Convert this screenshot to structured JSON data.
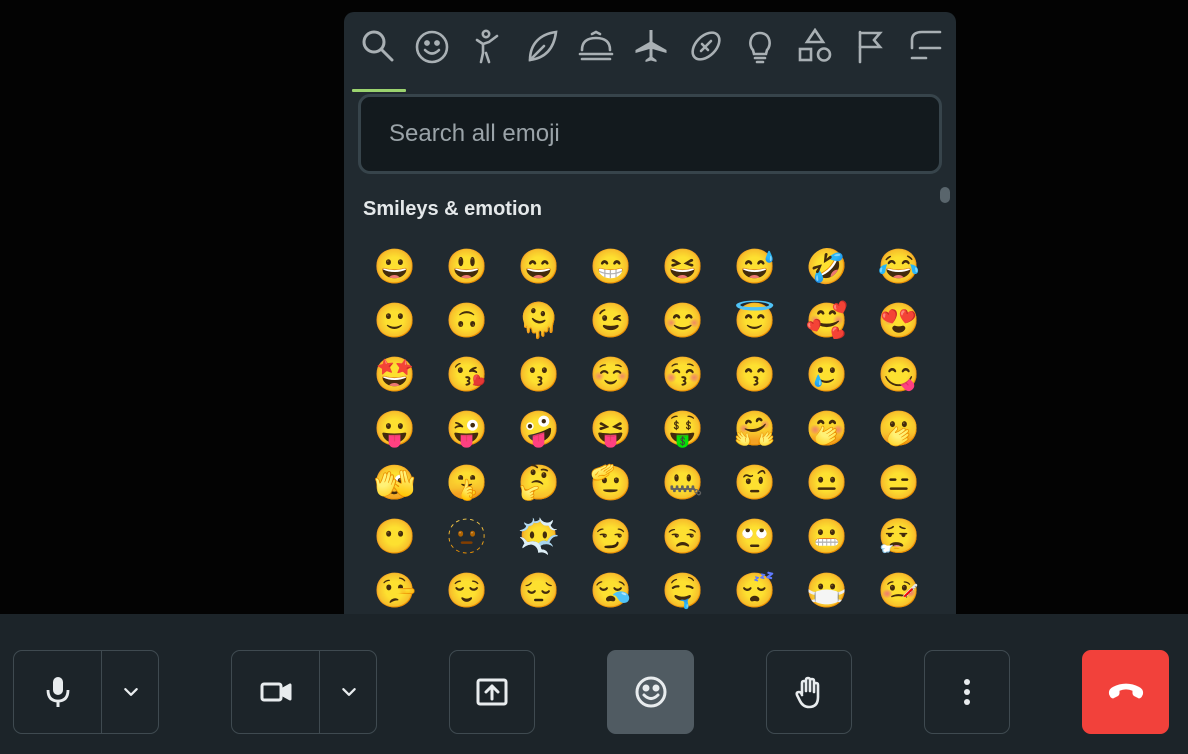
{
  "emoji_picker": {
    "categories": [
      {
        "name": "search-icon",
        "label": "Search"
      },
      {
        "name": "smiley-icon",
        "label": "Smileys & emotion"
      },
      {
        "name": "person-icon",
        "label": "People & body"
      },
      {
        "name": "leaf-icon",
        "label": "Animals & nature"
      },
      {
        "name": "food-icon",
        "label": "Food & drink"
      },
      {
        "name": "airplane-icon",
        "label": "Travel & places"
      },
      {
        "name": "football-icon",
        "label": "Activities"
      },
      {
        "name": "lightbulb-icon",
        "label": "Objects"
      },
      {
        "name": "shapes-icon",
        "label": "Symbols"
      },
      {
        "name": "flag-icon",
        "label": "Flags"
      },
      {
        "name": "custom-icon",
        "label": "Custom"
      }
    ],
    "active_category": "Search",
    "search": {
      "placeholder": "Search all emoji",
      "value": ""
    },
    "section_title": "Smileys & emotion",
    "emojis": [
      "😀",
      "😃",
      "😄",
      "😁",
      "😆",
      "😅",
      "🤣",
      "😂",
      "🙂",
      "🙃",
      "🫠",
      "😉",
      "😊",
      "😇",
      "🥰",
      "😍",
      "🤩",
      "😘",
      "😗",
      "☺️",
      "😚",
      "😙",
      "🥲",
      "😋",
      "😛",
      "😜",
      "🤪",
      "😝",
      "🤑",
      "🤗",
      "🤭",
      "🫢",
      "🫣",
      "🤫",
      "🤔",
      "🫡",
      "🤐",
      "🤨",
      "😐",
      "😑",
      "😶",
      "🫥",
      "😶‍🌫️",
      "😏",
      "😒",
      "🙄",
      "😬",
      "😮‍💨",
      "🤥",
      "😌",
      "😔",
      "😪",
      "🤤",
      "😴",
      "😷",
      "🤒",
      "🤕",
      "🤢",
      "🤮",
      "🤧",
      "🥵",
      "🥶",
      "🥴",
      "😵"
    ]
  },
  "toolbar": {
    "mic": {
      "icon": "microphone-icon",
      "options_icon": "chevron-down-icon"
    },
    "camera": {
      "icon": "video-camera-icon",
      "options_icon": "chevron-down-icon"
    },
    "share": {
      "icon": "share-screen-icon"
    },
    "reactions": {
      "icon": "smiley-icon",
      "active": true
    },
    "raise_hand": {
      "icon": "hand-icon"
    },
    "more": {
      "icon": "more-vertical-icon"
    },
    "hangup": {
      "icon": "phone-hangup-icon",
      "color": "#f2413b"
    }
  },
  "colors": {
    "picker_bg": "#212a30",
    "active_tab_indicator": "#9bd36f",
    "toolbar_bg": "#1c2429",
    "hangup": "#f2413b"
  }
}
